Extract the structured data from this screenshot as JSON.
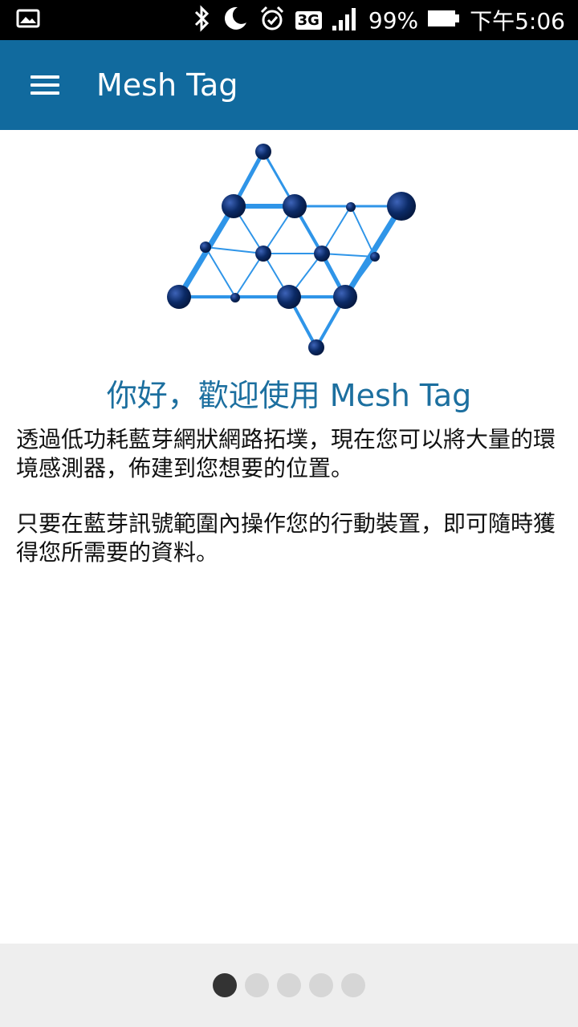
{
  "status_bar": {
    "battery": "99%",
    "time": "下午5:06",
    "network": "3G"
  },
  "app_bar": {
    "title": "Mesh Tag",
    "menu_icon": "hamburger-menu-icon"
  },
  "content": {
    "welcome": "你好，歡迎使用 Mesh Tag",
    "paragraph1": "透過低功耗藍芽網狀網路拓墣，現在您可以將大量的環境感測器，佈建到您想要的位置。",
    "paragraph2": "只要在藍芽訊號範圍內操作您的行動裝置，即可隨時獲得您所需要的資料。"
  },
  "pager": {
    "total_pages": 5,
    "current_page": 1
  },
  "colors": {
    "app_bar": "#116a9e",
    "accent_text": "#1c6f9f",
    "node": "#0b2a66",
    "link": "#2f95e8"
  }
}
